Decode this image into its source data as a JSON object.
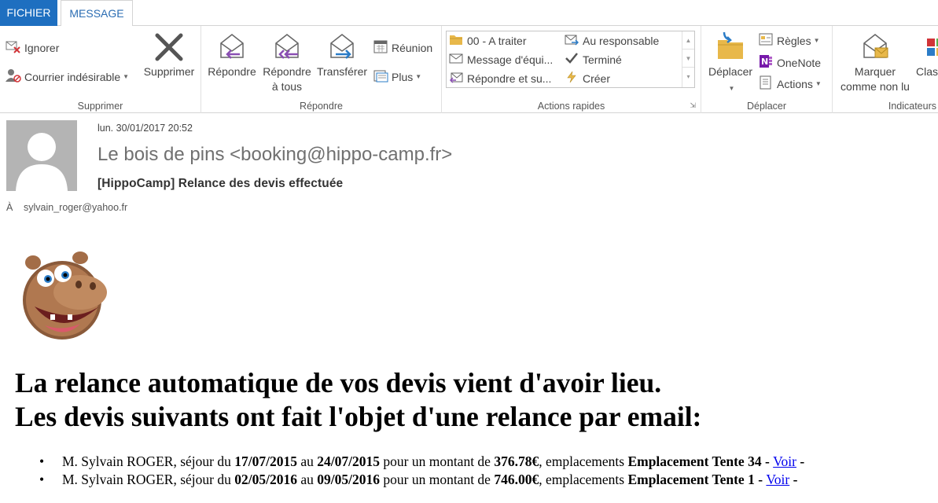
{
  "tabs": {
    "file": "FICHIER",
    "message": "MESSAGE"
  },
  "ribbon": {
    "delete_group": {
      "label": "Supprimer",
      "ignore": "Ignorer",
      "junk": "Courrier indésirable",
      "delete": "Supprimer"
    },
    "respond_group": {
      "label": "Répondre",
      "reply_line1": "Répondre",
      "reply_all_line1": "Répondre",
      "reply_all_line2": "à tous",
      "forward": "Transférer",
      "meeting": "Réunion",
      "more": "Plus"
    },
    "quick_steps": {
      "label": "Actions rapides",
      "items": [
        "00 - A traiter",
        "Au responsable",
        "Message d'équi...",
        "Terminé",
        "Répondre et su...",
        "Créer"
      ]
    },
    "move_group": {
      "label": "Déplacer",
      "move": "Déplacer",
      "rules": "Règles",
      "onenote": "OneNote",
      "actions": "Actions"
    },
    "tags_group": {
      "label": "Indicateurs",
      "mark_unread_line1": "Marquer",
      "mark_unread_line2": "comme non lu",
      "categorize": "Clas"
    }
  },
  "message": {
    "date": "lun. 30/01/2017 20:52",
    "sender": "Le bois de pins <booking@hippo-camp.fr>",
    "subject": "[HippoCamp] Relance des devis effectuée",
    "to_label": "À",
    "to_value": "sylvain_roger@yahoo.fr"
  },
  "body": {
    "headline_line1": "La relance automatique de vos devis vient d'avoir lieu.",
    "headline_line2": "Les devis suivants ont fait l'objet d'une relance par email:",
    "quotes": [
      {
        "prefix": "M. Sylvain ROGER, séjour du ",
        "from": "17/07/2015",
        "mid1": " au ",
        "to": "24/07/2015",
        "mid2": " pour un montant de ",
        "amount": "376.78€",
        "mid3": ", emplacements ",
        "place": "Emplacement Tente 34 - ",
        "link": "Voir",
        "suffix": " -"
      },
      {
        "prefix": "M. Sylvain ROGER, séjour du ",
        "from": "02/05/2016",
        "mid1": " au ",
        "to": "09/05/2016",
        "mid2": " pour un montant de ",
        "amount": "746.00€",
        "mid3": ", emplacements ",
        "place": "Emplacement Tente 1 - ",
        "link": "Voir",
        "suffix": " -"
      }
    ]
  },
  "colors": {
    "accent": "#1e6fc0",
    "tab_text": "#2b6db3",
    "link": "#0000ee"
  }
}
